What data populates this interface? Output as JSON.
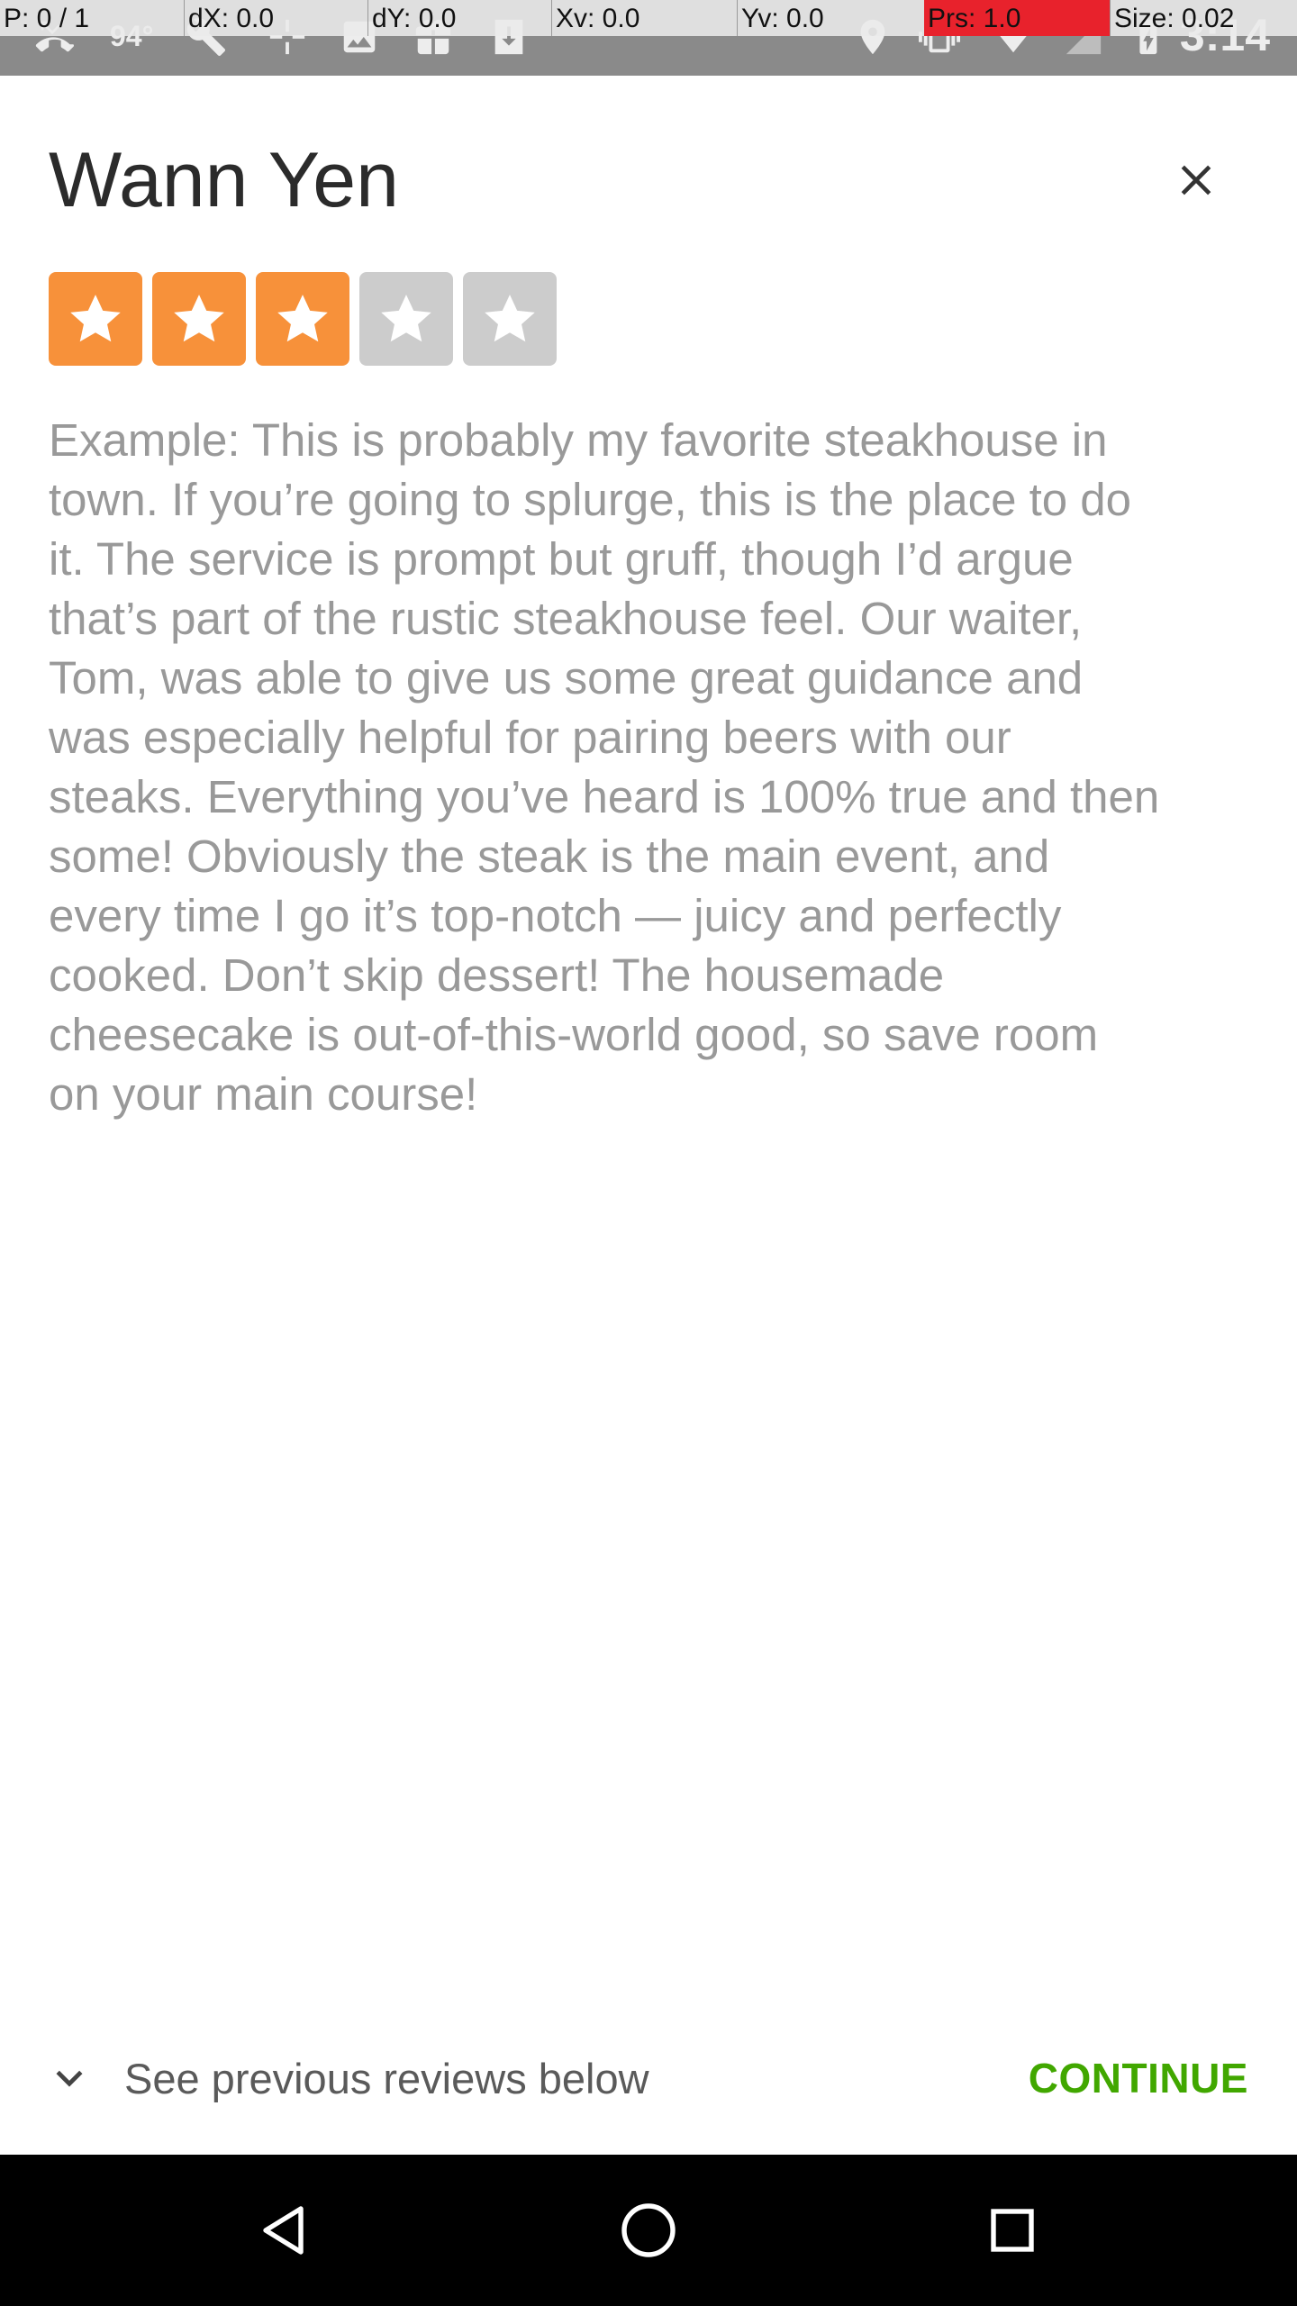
{
  "status_bar": {
    "temperature": "94°",
    "time": "3:14",
    "icons": [
      "missed-call-icon",
      "wrench-icon",
      "crosshair-icon",
      "image-icon",
      "gift-icon",
      "download-icon",
      "location-pin-icon",
      "vibrate-icon",
      "wifi-icon",
      "signal-icon",
      "battery-charging-icon"
    ],
    "pointer_overlay": {
      "p": "P: 0 / 1",
      "dx": "dX: 0.0",
      "dy": "dY: 0.0",
      "xv": "Xv: 0.0",
      "yv": "Yv: 0.0",
      "prs": "Prs: 1.0",
      "size": "Size: 0.02"
    }
  },
  "dialog": {
    "title": "Wann Yen",
    "rating": {
      "value": 3,
      "max": 5,
      "active_color": "#f7913a",
      "inactive_color": "#cccccc"
    },
    "review_placeholder": "Example: This is probably my favorite steakhouse in\ntown. If you’re going to splurge, this is the place to do\nit. The service is prompt but gruff, though I’d argue\nthat’s part of the rustic steakhouse feel. Our waiter,\nTom, was able to give us some great guidance and\nwas especially helpful for pairing beers with our\nsteaks. Everything you’ve heard is 100% true and then\nsome! Obviously the steak is the main event, and\nevery time I go it’s top-notch — juicy and perfectly\ncooked. Don’t skip dessert! The housemade\ncheesecake is out-of-this-world good, so save room\non your main course!",
    "see_previous_label": "See previous reviews below",
    "continue_label": "CONTINUE",
    "continue_color": "#41a700"
  },
  "nav_bar": {
    "buttons": [
      "back-icon",
      "home-icon",
      "recents-icon"
    ]
  }
}
